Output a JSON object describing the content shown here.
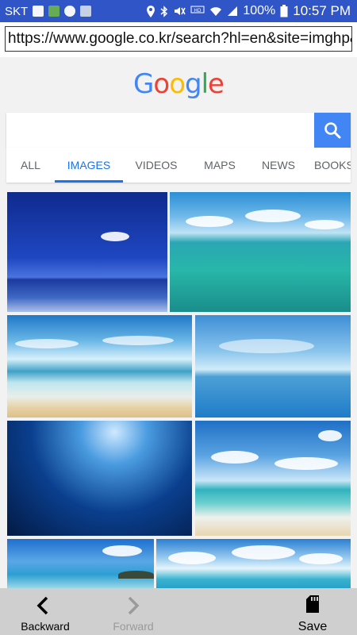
{
  "status_bar": {
    "carrier": "SKT",
    "battery": "100%",
    "time": "10:57 PM",
    "icons": [
      "image-icon",
      "gallery-icon",
      "w-app-icon",
      "clipboard-icon",
      "location-icon",
      "bluetooth-icon",
      "mute-icon",
      "volte-icon",
      "wifi-icon",
      "signal-icon",
      "battery-icon"
    ]
  },
  "browser": {
    "url": "https://www.google.co.kr/search?hl=en&site=imghp&tbm=isch"
  },
  "google": {
    "logo_letters": [
      "G",
      "o",
      "o",
      "g",
      "l",
      "e"
    ],
    "logo_colors": [
      "#4285f4",
      "#ea4335",
      "#fbbc05",
      "#4285f4",
      "#34a853",
      "#ea4335"
    ],
    "search_value": "",
    "search_button_color": "#4285f4"
  },
  "tabs": [
    {
      "label": "ALL",
      "active": false
    },
    {
      "label": "IMAGES",
      "active": true
    },
    {
      "label": "VIDEOS",
      "active": false
    },
    {
      "label": "MAPS",
      "active": false
    },
    {
      "label": "NEWS",
      "active": false
    },
    {
      "label": "BOOKS",
      "active": false
    }
  ],
  "results": {
    "images": [
      "ocean-image-1",
      "ocean-image-2",
      "beach-image-3",
      "sky-sea-image-4",
      "underwater-image-5",
      "beach-image-6",
      "island-image-7",
      "sea-image-8"
    ]
  },
  "bottom_bar": {
    "back_label": "Backward",
    "forward_label": "Forward",
    "save_label": "Save"
  }
}
